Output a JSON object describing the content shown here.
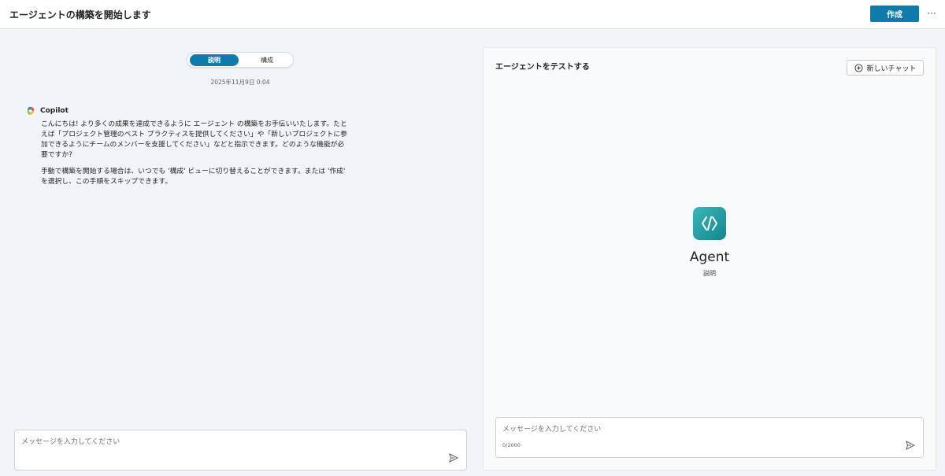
{
  "header": {
    "title": "エージェントの構築を開始します",
    "create_label": "作成",
    "more_label": "···"
  },
  "left": {
    "tabs": [
      {
        "label": "説明",
        "active": true
      },
      {
        "label": "構成",
        "active": false
      }
    ],
    "timestamp": "2025年11月9日 0:04",
    "assistant_name": "Copilot",
    "message_paragraph_1": "こんにちは! より多くの成果を達成できるように エージェント の構築をお手伝いいたします。たとえば「プロジェクト管理のベスト プラクティスを提供してください」や「新しいプロジェクトに参加できるようにチームのメンバーを支援してください」などと指示できます。どのような機能が必要ですか?",
    "message_paragraph_2": "手動で構築を開始する場合は、いつでも '構成' ビューに切り替えることができます。または '作成' を選択し、この手順をスキップできます。",
    "input_placeholder": "メッセージを入力してください"
  },
  "right": {
    "title": "エージェントをテストする",
    "new_chat_label": "新しいチャット",
    "agent_name": "Agent",
    "agent_description": "説明",
    "input_placeholder": "メッセージを入力してください",
    "char_count": "0/2000"
  },
  "colors": {
    "accent": "#0f7bab",
    "agent_icon": "#1e9ea4",
    "background": "#f1f4f8"
  },
  "icons": {
    "more": "more-horizontal-icon",
    "copilot": "copilot-logo-icon",
    "new_chat": "chat-add-icon",
    "agent": "agent-code-icon",
    "send": "send-icon"
  }
}
